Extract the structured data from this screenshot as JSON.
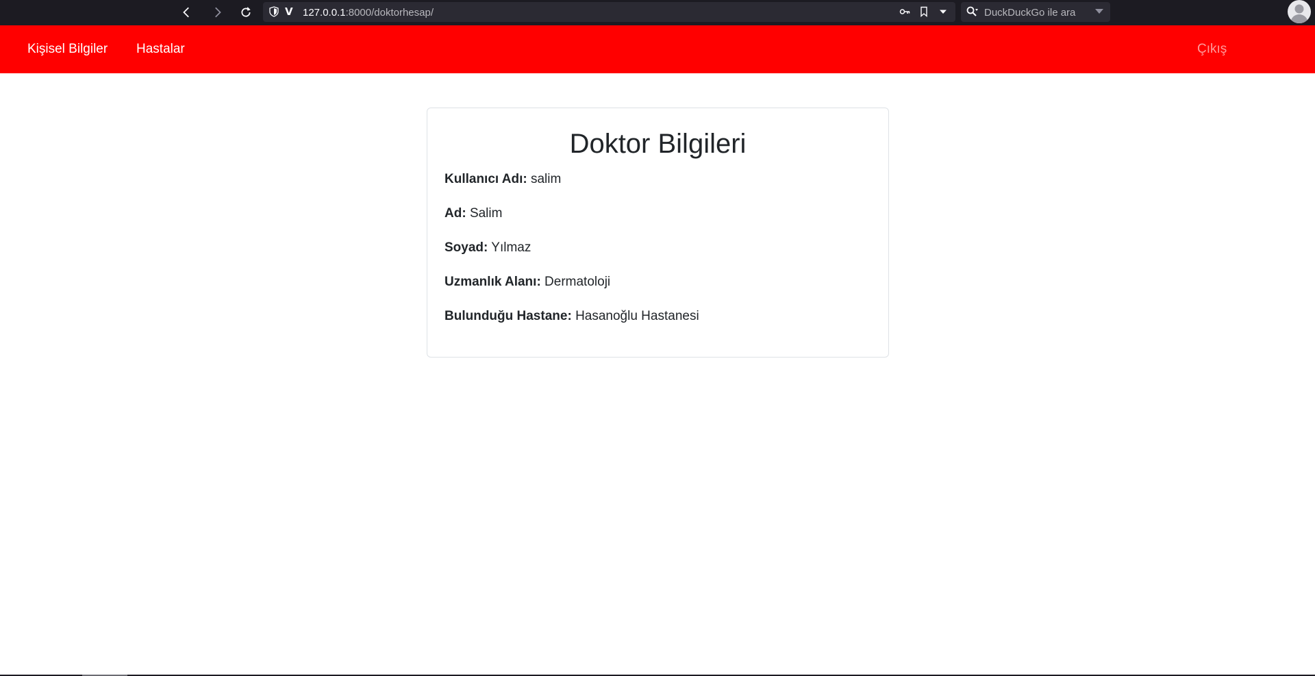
{
  "browser": {
    "url_host": "127.0.0.1",
    "url_rest": ":8000/doktorhesap/",
    "search_placeholder": "DuckDuckGo ile ara"
  },
  "navbar": {
    "links": [
      {
        "label": "Kişisel Bilgiler"
      },
      {
        "label": "Hastalar"
      }
    ],
    "logout_label": "Çıkış",
    "background_color": "#ff0000"
  },
  "card": {
    "title": "Doktor Bilgileri",
    "fields": [
      {
        "label": "Kullanıcı Adı:",
        "value": "salim"
      },
      {
        "label": "Ad:",
        "value": "Salim"
      },
      {
        "label": "Soyad:",
        "value": "Yılmaz"
      },
      {
        "label": "Uzmanlık Alanı:",
        "value": "Dermatoloji"
      },
      {
        "label": "Bulunduğu Hastane:",
        "value": "Hasanoğlu Hastanesi"
      }
    ]
  }
}
